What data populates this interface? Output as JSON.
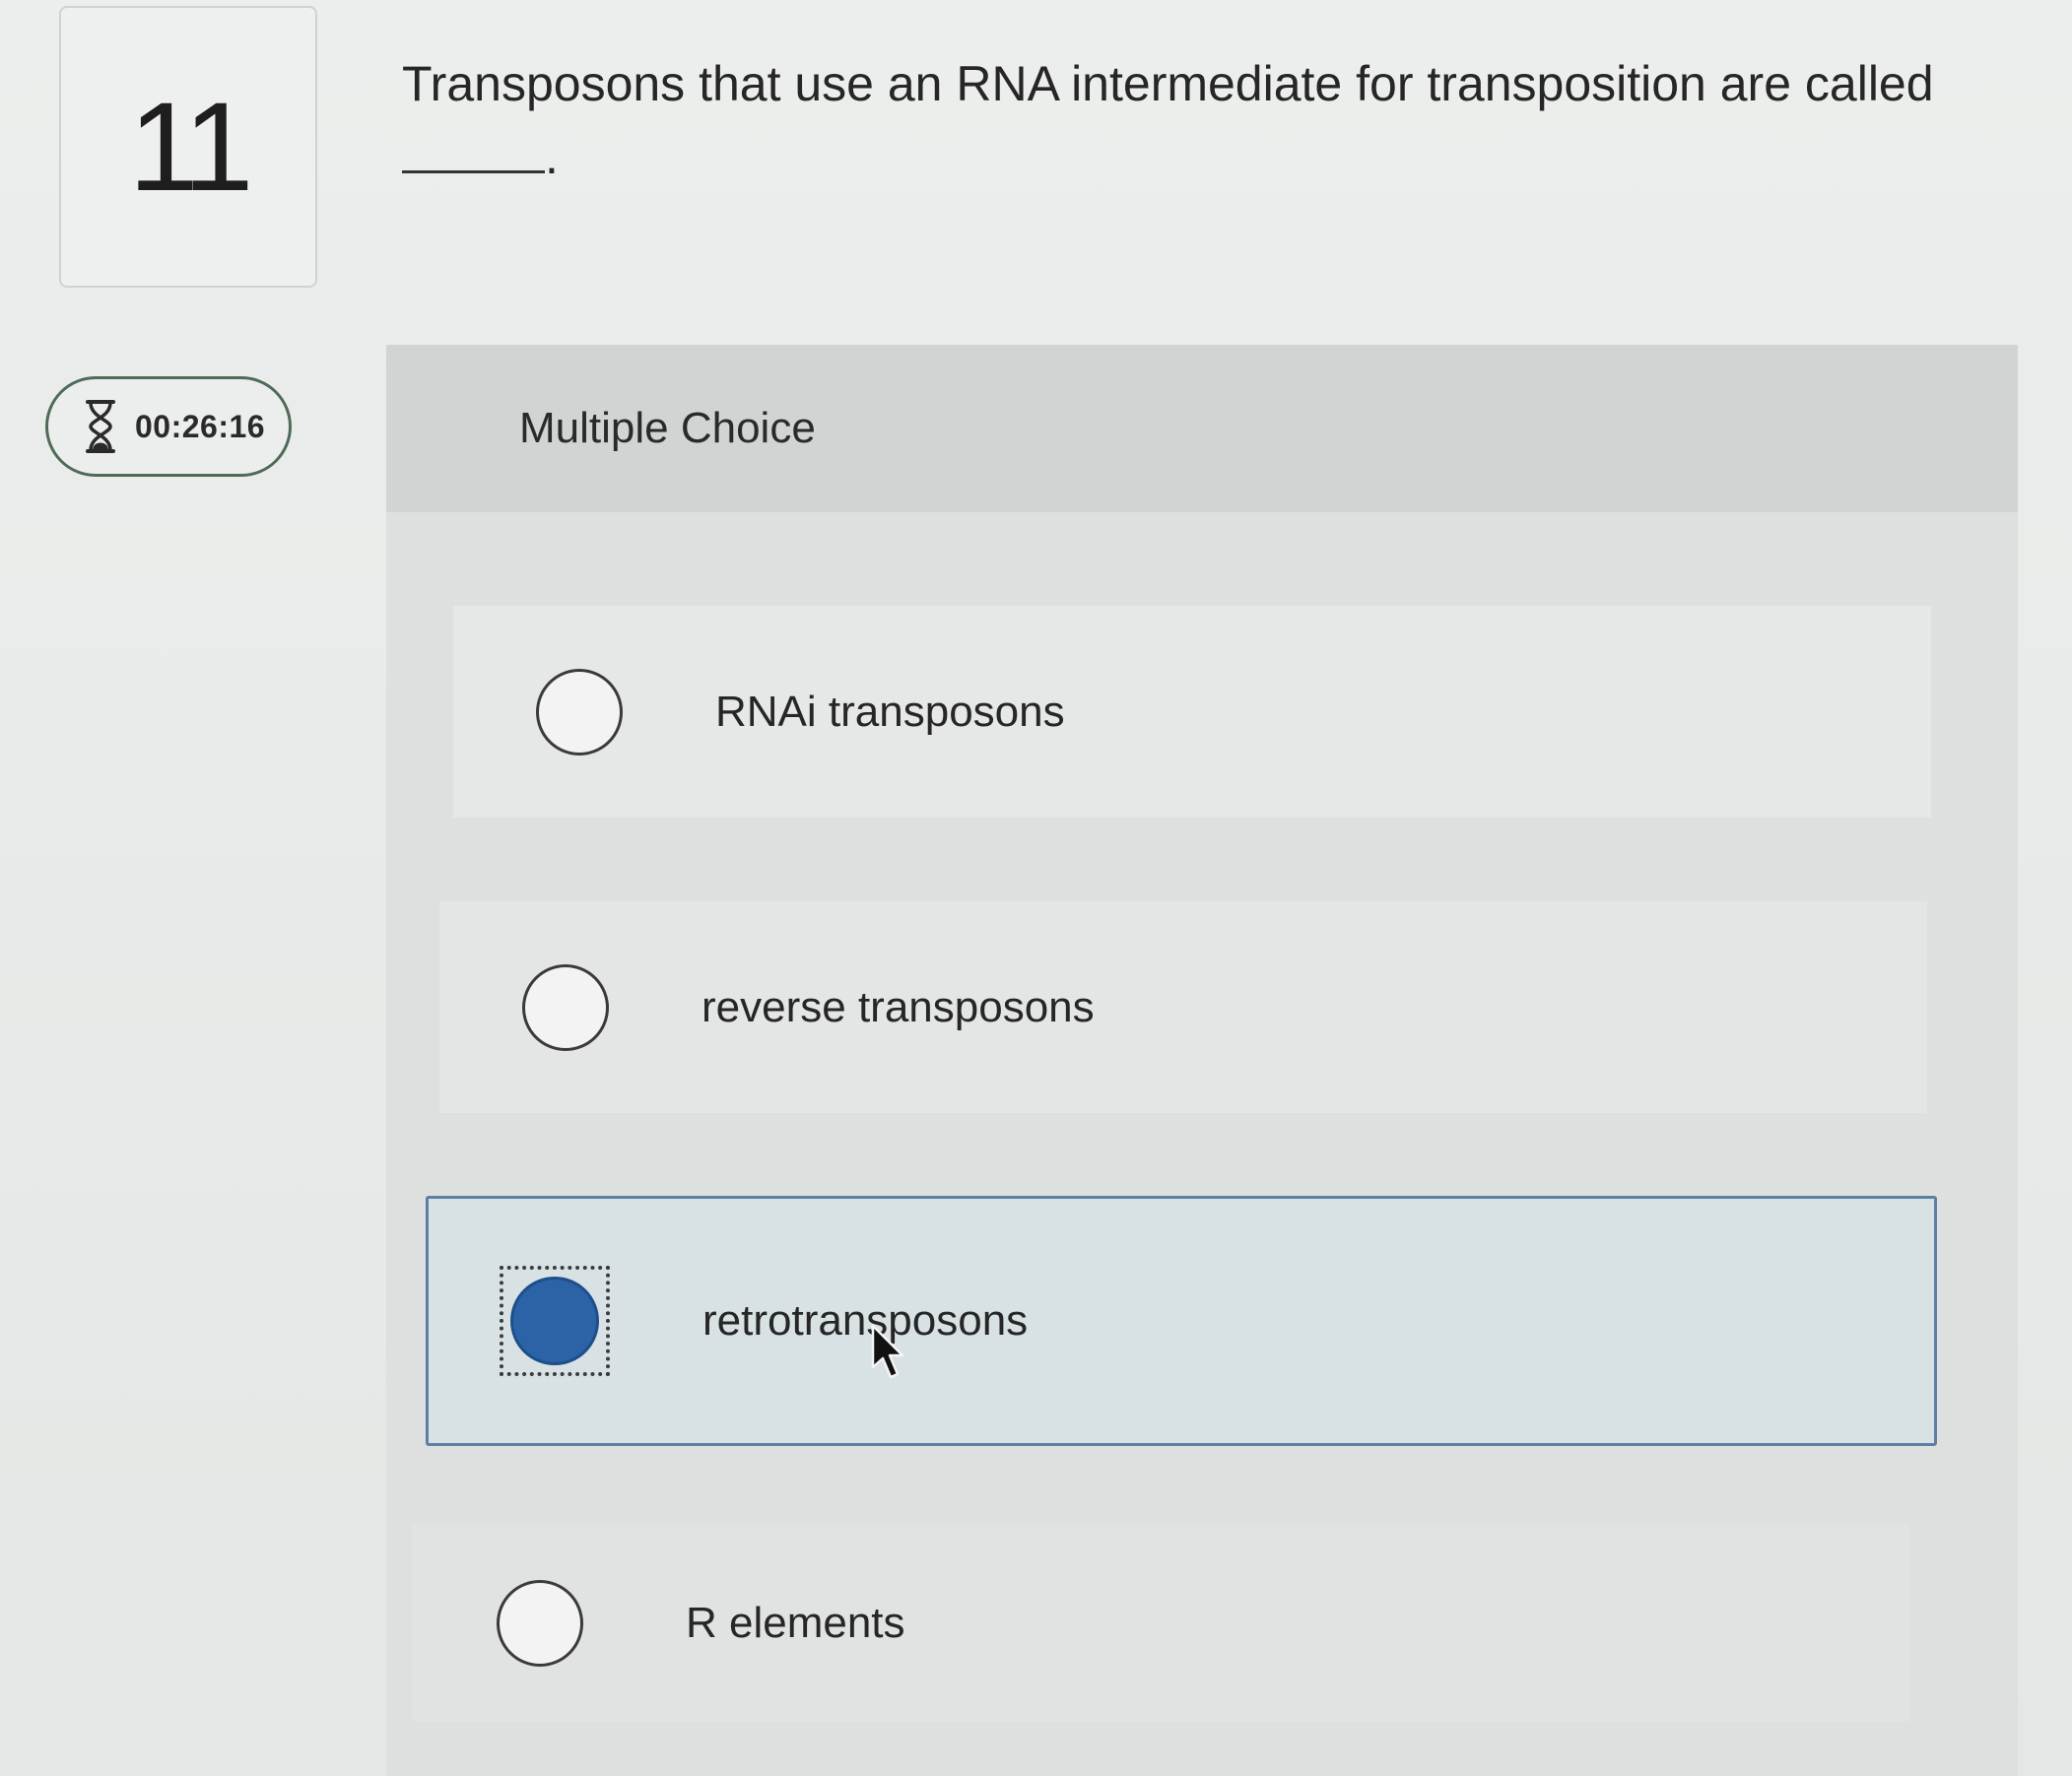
{
  "question": {
    "number": "11",
    "text": "Transposons that use an RNA intermediate for transposition are called",
    "blank_suffix": "."
  },
  "timer": {
    "icon": "hourglass-icon",
    "value": "00:26:16"
  },
  "multiple_choice": {
    "header": "Multiple Choice",
    "options": [
      {
        "label": "RNAi transposons",
        "selected": false
      },
      {
        "label": "reverse transposons",
        "selected": false
      },
      {
        "label": "retrotransposons",
        "selected": true
      },
      {
        "label": "R elements",
        "selected": false
      }
    ]
  },
  "colors": {
    "selected_radio": "#2b63a6",
    "selected_border": "#5d7fa4",
    "timer_border": "#4f6a57"
  }
}
